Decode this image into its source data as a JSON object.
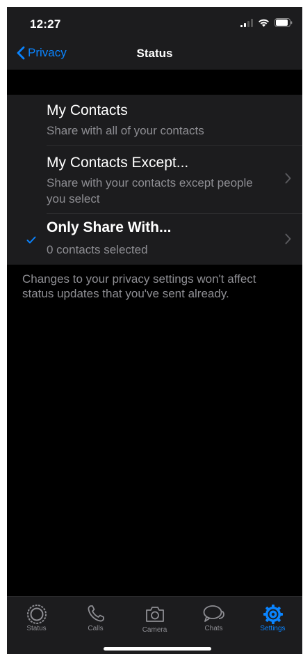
{
  "status_bar": {
    "time": "12:27"
  },
  "nav": {
    "back_label": "Privacy",
    "title": "Status"
  },
  "options": [
    {
      "title": "My Contacts",
      "subtitle": "Share with all of your contacts"
    },
    {
      "title": "My Contacts Except...",
      "subtitle": "Share with your contacts except people you select"
    },
    {
      "title": "Only Share With...",
      "subtitle": "0 contacts selected"
    }
  ],
  "selected_option": "Only Share With...",
  "footer_note": "Changes to your privacy settings won't affect status updates that you've sent already.",
  "tabs": [
    {
      "label": "Status",
      "icon": "status-icon"
    },
    {
      "label": "Calls",
      "icon": "phone-icon"
    },
    {
      "label": "Camera",
      "icon": "camera-icon"
    },
    {
      "label": "Chats",
      "icon": "chat-bubbles-icon"
    },
    {
      "label": "Settings",
      "icon": "gear-icon"
    }
  ],
  "active_tab": "Settings",
  "colors": {
    "accent": "#0a84ff",
    "background": "#000000",
    "cell": "#1c1c1e",
    "secondary_text": "#8e8e93"
  }
}
